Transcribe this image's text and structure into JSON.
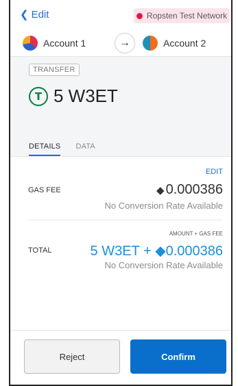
{
  "header": {
    "back_label": "Edit",
    "network": {
      "label": "Ropsten Test Network",
      "color": "#e91550"
    }
  },
  "accounts": {
    "from": {
      "name": "Account 1"
    },
    "to": {
      "name": "Account 2"
    }
  },
  "summary": {
    "action_tag": "TRANSFER",
    "token_symbol_icon": "T",
    "amount": "5 W3ET"
  },
  "tabs": [
    {
      "label": "DETAILS",
      "active": true
    },
    {
      "label": "DATA",
      "active": false
    }
  ],
  "details": {
    "edit_label": "EDIT",
    "gas_fee_label": "GAS FEE",
    "gas_fee_value": "0.000386",
    "gas_no_rate": "No Conversion Rate Available",
    "amount_gas_label": "AMOUNT + GAS FEE",
    "total_label": "TOTAL",
    "total_value": "5 W3ET + ◆0.000386",
    "total_no_rate": "No Conversion Rate Available"
  },
  "footer": {
    "reject_label": "Reject",
    "confirm_label": "Confirm"
  },
  "colors": {
    "accent": "#1f6dd6",
    "confirm": "#0a6ecb",
    "token_green": "#0a7f3c"
  }
}
